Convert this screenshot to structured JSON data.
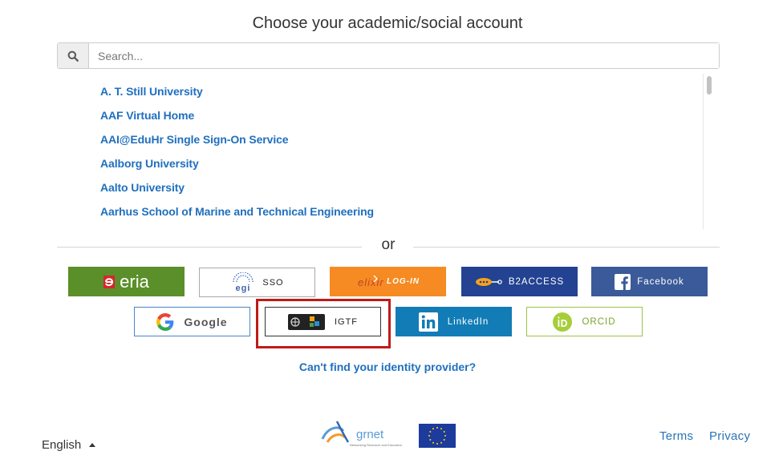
{
  "page": {
    "title": "Choose your academic/social account"
  },
  "search": {
    "placeholder": "Search...",
    "icon": "search-icon"
  },
  "idp_list": [
    "A. T. Still University",
    "AAF Virtual Home",
    "AAI@EduHr Single Sign-On Service",
    "Aalborg University",
    "Aalto University",
    "Aarhus School of Marine and Technical Engineering"
  ],
  "separator": "or",
  "providers": {
    "eria": {
      "label": "eria",
      "color": "#5a8f29"
    },
    "egi": {
      "logo": "egi",
      "label": "SSO"
    },
    "elixir": {
      "logo": "elixir",
      "label": "LOG-IN",
      "color": "#f58b22"
    },
    "b2access": {
      "label": "B2ACCESS",
      "color": "#234291"
    },
    "facebook": {
      "label": "Facebook",
      "color": "#3b5a99"
    },
    "google": {
      "label": "Google"
    },
    "igtf": {
      "label": "IGTF"
    },
    "linkedin": {
      "label": "LinkedIn",
      "color": "#127cb6"
    },
    "orcid": {
      "label": "ORCID",
      "color": "#9dc24a"
    }
  },
  "help_link": "Can't find your identity provider?",
  "footer": {
    "language": "English",
    "grnet_logo": "grnet",
    "grnet_tagline": "Networking Research and Education",
    "terms": "Terms",
    "privacy": "Privacy"
  },
  "colors": {
    "link": "#1f6fbe",
    "highlight": "#c01a1a"
  }
}
